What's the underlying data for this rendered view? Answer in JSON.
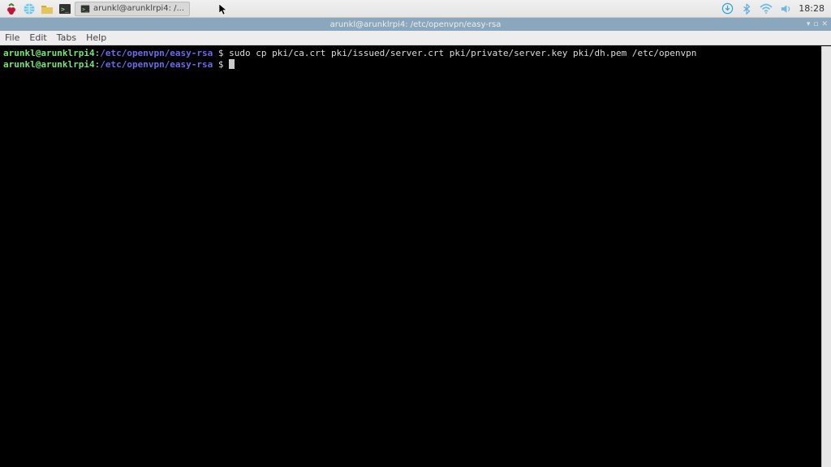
{
  "taskbar": {
    "app_title": "arunkl@arunklrpi4: /...",
    "clock": "18:28"
  },
  "window": {
    "title": "arunkl@arunklrpi4: /etc/openvpn/easy-rsa"
  },
  "menubar": {
    "file": "File",
    "edit": "Edit",
    "tabs": "Tabs",
    "help": "Help"
  },
  "terminal": {
    "lines": [
      {
        "userhost": "arunkl@arunklrpi4",
        "colon": ":",
        "path": "/etc/openvpn/easy-rsa",
        "dollar": " $ ",
        "cmd": "sudo cp pki/ca.crt pki/issued/server.crt pki/private/server.key pki/dh.pem /etc/openvpn"
      },
      {
        "userhost": "arunkl@arunklrpi4",
        "colon": ":",
        "path": "/etc/openvpn/easy-rsa",
        "dollar": " $ ",
        "cmd": ""
      }
    ]
  },
  "tray": {
    "download_color": "#2aa4d8",
    "bluetooth_color": "#5aa8e0",
    "wifi_color": "#6fb8e5",
    "volume_color": "#6fb8e5"
  }
}
